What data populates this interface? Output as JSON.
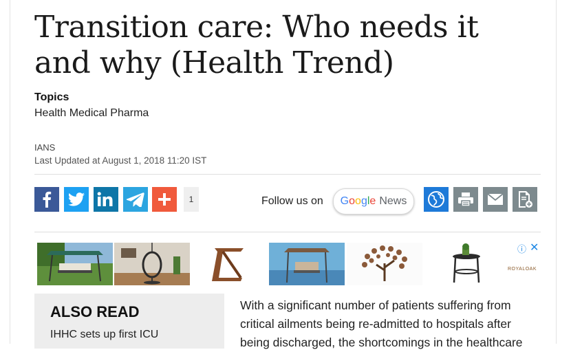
{
  "article": {
    "title_line1": "Transition care: Who needs it",
    "title_line2": "and why (Health Trend)",
    "topics_label": "Topics",
    "topics_value": "Health Medical Pharma",
    "byline": "IANS",
    "updated": "Last Updated at August 1, 2018 11:20 IST"
  },
  "share": {
    "facebook_icon": "facebook-icon",
    "twitter_icon": "twitter-icon",
    "linkedin_icon": "linkedin-icon",
    "telegram_icon": "telegram-icon",
    "more_icon": "plus-icon",
    "count": "1",
    "colors": {
      "facebook": "#3b5998",
      "twitter": "#1da1f2",
      "linkedin": "#0e76a8",
      "telegram": "#2ca5e0",
      "more": "#f05a3c"
    }
  },
  "follow": {
    "label": "Follow us on",
    "google_parts": [
      "G",
      "o",
      "o",
      "g",
      "l",
      "e"
    ],
    "google_colors": [
      "#4285f4",
      "#ea4335",
      "#fbbc05",
      "#4285f4",
      "#34a853",
      "#ea4335"
    ],
    "news_word": "News"
  },
  "tools": {
    "globe_icon": "globe-icon",
    "print_icon": "print-icon",
    "email_icon": "email-icon",
    "document_icon": "document-add-icon",
    "globe_color": "#1e7ad8",
    "tool_color": "#7d8a8e"
  },
  "ad": {
    "info_icon": "ⓘ",
    "close_icon": "✕",
    "brand": "ROYALOAK"
  },
  "also_read": {
    "title": "ALSO READ",
    "first_link": "IHHC sets up first ICU"
  },
  "body": {
    "lines": [
      "With a significant number of patients suffering from",
      "critical ailments being re-admitted to hospitals after",
      "being discharged, the shortcomings in the healthcare"
    ]
  }
}
